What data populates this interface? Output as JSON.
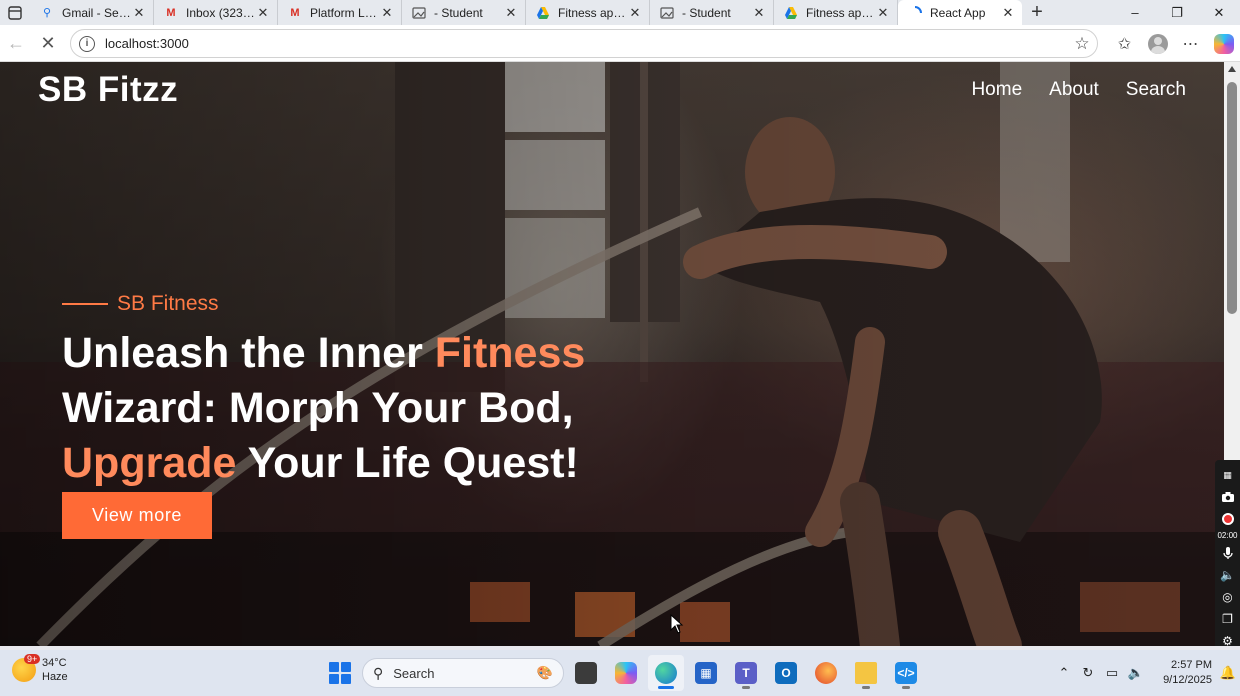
{
  "browser": {
    "tabs": [
      {
        "title": "Gmail - Search",
        "icon": "search-icon"
      },
      {
        "title": "Inbox (323) - r",
        "icon": "gmail-icon"
      },
      {
        "title": "Platform Login",
        "icon": "gmail-icon"
      },
      {
        "title": "- Student",
        "icon": "image-icon"
      },
      {
        "title": "Fitness app (R",
        "icon": "drive-icon"
      },
      {
        "title": "- Student",
        "icon": "image-icon"
      },
      {
        "title": "Fitness app (R",
        "icon": "drive-icon"
      },
      {
        "title": "React App",
        "icon": "loading-icon"
      }
    ],
    "active_tab_index": 7,
    "address": "localhost:3000"
  },
  "site": {
    "logo": "SB Fitzz",
    "nav": [
      "Home",
      "About",
      "Search"
    ],
    "kicker": "SB Fitness",
    "headline": {
      "line1_a": "Unleash the Inner ",
      "line1_b": "Fitness",
      "line2": "Wizard: Morph Your Bod,",
      "line3_a": "Upgrade",
      "line3_b": " Your Life Quest!"
    },
    "cta": "View more"
  },
  "recorder": {
    "time": "02:00"
  },
  "taskbar": {
    "weather_temp": "34°C",
    "weather_desc": "Haze",
    "weather_badge": "9+",
    "search_placeholder": "Search",
    "time": "2:57 PM",
    "date": "9/12/2025"
  },
  "colors": {
    "accent": "#ff6a36",
    "accent_text": "#ff8a5c"
  }
}
